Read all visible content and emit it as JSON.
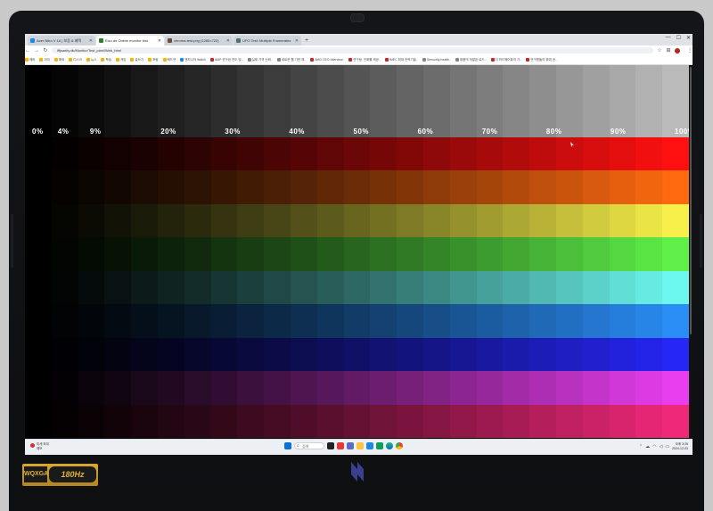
{
  "browser": {
    "tabs": [
      {
        "label": "Acer Nitro V 16 | 보증 & 혜택",
        "favicon": "#1e88e5",
        "active": false
      },
      {
        "label": "Eizo.de Online monitor test",
        "favicon": "#2e7d32",
        "active": true
      },
      {
        "label": "chroma-test.png (1280×720)",
        "favicon": "#6d4c41",
        "active": false
      },
      {
        "label": "UFO Test: Multiple Framerates",
        "favicon": "#546e7a",
        "active": false
      }
    ],
    "new_tab_label": "+",
    "window_controls": [
      "—",
      "☐",
      "✕"
    ],
    "url": "lffjsaeity.dk/Monitor/Test_pixel/Web_html",
    "bookmarks": [
      {
        "label": "에버",
        "color": "#f4b400"
      },
      {
        "label": "미국",
        "color": "#f4b400"
      },
      {
        "label": "해외",
        "color": "#f4b400"
      },
      {
        "label": "디스크",
        "color": "#f4b400"
      },
      {
        "label": "뉴스",
        "color": "#f4b400"
      },
      {
        "label": "학습",
        "color": "#f4b400"
      },
      {
        "label": "게임",
        "color": "#f4b400"
      },
      {
        "label": "글쓰기",
        "color": "#f4b400"
      },
      {
        "label": "포럼",
        "color": "#f4b400"
      },
      {
        "label": "헤드셋",
        "color": "#f4b400"
      },
      {
        "label": "엔지니어 Watch",
        "color": "#1e88e5"
      },
      {
        "label": "AMP 연구된 연도 및..",
        "color": "#c62828"
      },
      {
        "label": "실제 가격 신뢰..",
        "color": "#888888"
      },
      {
        "label": "새로운 웹 기반 제..",
        "color": "#888888"
      },
      {
        "label": "AMD CEO Interview..",
        "color": "#c62828"
      },
      {
        "label": "연구팀, 진화를 제공..",
        "color": "#c62828"
      },
      {
        "label": "IMEC 최대 전력기술..",
        "color": "#c62828"
      },
      {
        "label": "Sensority health..",
        "color": "#888888"
      },
      {
        "label": "제품의 개발된 로드..",
        "color": "#888888"
      },
      {
        "label": "더 하드웨어퓨처 기..",
        "color": "#c62828"
      },
      {
        "label": "연구원들의 위에 공..",
        "color": "#c62828"
      }
    ]
  },
  "test_page": {
    "percent_labels": [
      "0%",
      "4%",
      "9%",
      "20%",
      "30%",
      "40%",
      "50%",
      "60%",
      "70%",
      "80%",
      "90%",
      "100%"
    ],
    "step_count": 25,
    "gray_max_level": 0.73,
    "bar_colors": [
      "#ff1010",
      "#ff6a10",
      "#f7f04a",
      "#5ef048",
      "#6cf7ee",
      "#2a8cf5",
      "#2626f5",
      "#e83ef0",
      "#f0287a"
    ]
  },
  "taskbar": {
    "weather_line1": "미세 최대",
    "weather_line2": "예보",
    "search_placeholder": "검색",
    "apps": [
      "windows",
      "search",
      "widgets",
      "chat",
      "files",
      "explorer",
      "store",
      "mail",
      "edge",
      "chrome"
    ],
    "clock_time": "오후 3:25",
    "clock_date": "2024-12-03"
  },
  "device": {
    "sticker_left": "WQXGA",
    "sticker_right": "180Hz",
    "brand_color": "#3a3f8f"
  }
}
